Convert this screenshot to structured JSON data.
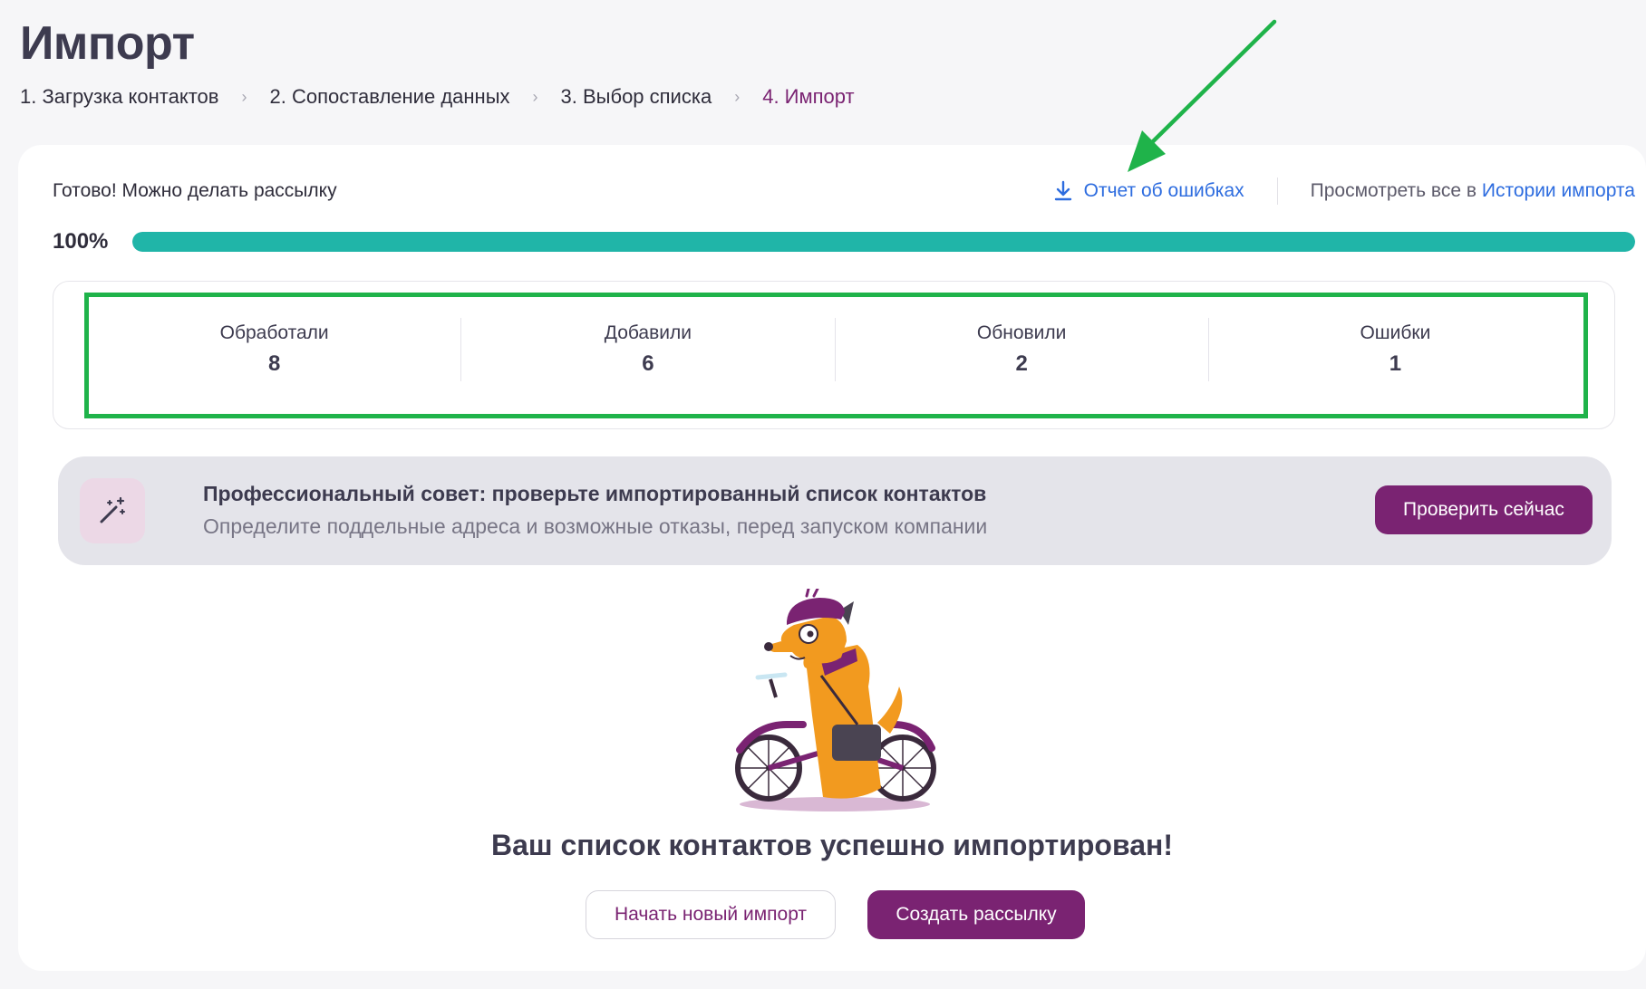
{
  "page": {
    "title": "Импорт"
  },
  "breadcrumb": [
    {
      "label": "1. Загрузка контактов"
    },
    {
      "label": "2. Сопоставление данных"
    },
    {
      "label": "3. Выбор списка"
    },
    {
      "label": "4. Импорт"
    }
  ],
  "status": {
    "text": "Готово! Можно делать рассылку",
    "report_link": "Отчет об ошибках",
    "report_icon": "download-icon",
    "history_prefix": "Просмотреть все в",
    "history_link": "Истории импорта"
  },
  "progress": {
    "label": "100%",
    "value": 1.0
  },
  "stats": [
    {
      "label": "Обработали",
      "value": "8"
    },
    {
      "label": "Добавили",
      "value": "6"
    },
    {
      "label": "Обновили",
      "value": "2"
    },
    {
      "label": "Ошибки",
      "value": "1"
    }
  ],
  "tip": {
    "icon": "magic-wand-icon",
    "title": "Профессиональный совет: проверьте импортированный список контактов",
    "subtitle": "Определите поддельные адреса и возможные отказы, перед запуском компании",
    "button": "Проверить сейчас"
  },
  "result": {
    "message": "Ваш список контактов успешно импортирован!",
    "new_import_button": "Начать новый импорт",
    "create_campaign_button": "Создать рассылку"
  },
  "colors": {
    "accent": "#7a2372",
    "link": "#2d6cdf",
    "progress": "#20b5a8",
    "annotation": "#1fb34a"
  }
}
